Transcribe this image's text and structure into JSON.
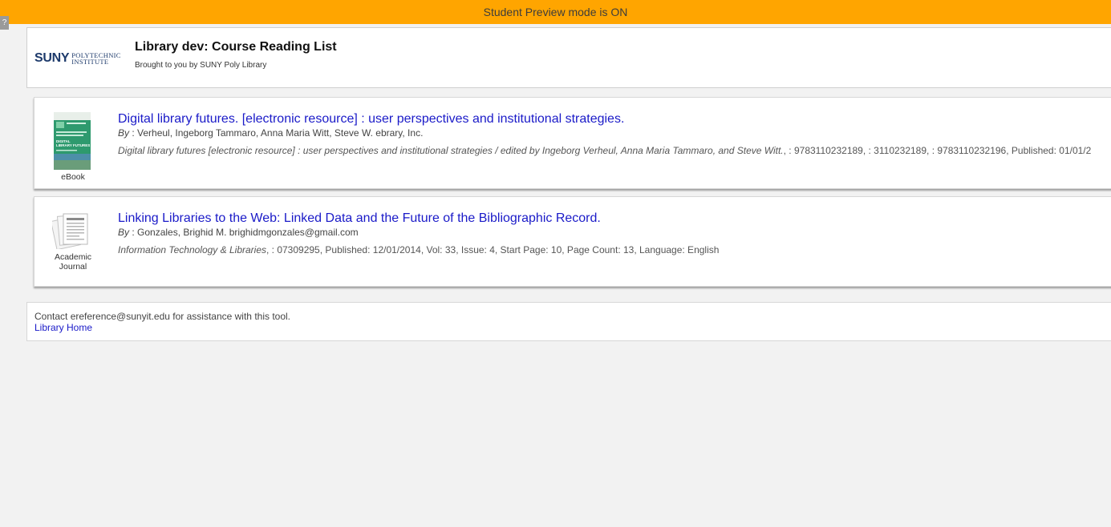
{
  "banner": {
    "text": "Student Preview mode is ON"
  },
  "side_tab": {
    "glyph": "?"
  },
  "header": {
    "logo_main": "SUNY",
    "logo_line1": "POLYTECHNIC",
    "logo_line2": "INSTITUTE",
    "title": "Library dev: Course Reading List",
    "subtitle": "Brought to you by SUNY Poly Library"
  },
  "items": [
    {
      "format": "eBook",
      "title": "Digital library futures. [electronic resource] : user perspectives and institutional strategies.",
      "by_label": "By",
      "authors": " : Verheul, Ingeborg Tammaro, Anna Maria Witt, Steve W. ebrary, Inc.",
      "source": "Digital library futures [electronic resource] : user perspectives and institutional strategies / edited by Ingeborg Verheul, Anna Maria Tammaro, and Steve Witt.",
      "details": ", : 9783110232189, : 3110232189, : 9783110232196, Published: 01/01/2",
      "cover_lines": [
        "DIGITAL",
        "LIBRARY FUTURES"
      ]
    },
    {
      "format": "Academic Journal",
      "title": "Linking Libraries to the Web: Linked Data and the Future of the Bibliographic Record.",
      "by_label": "By",
      "authors": " : Gonzales, Brighid M. brighidmgonzales@gmail.com",
      "source": "Information Technology & Libraries",
      "details": ", : 07309295, Published: 12/01/2014, Vol: 33, Issue: 4, Start Page: 10, Page Count: 13, Language: English"
    }
  ],
  "footer": {
    "contact": "Contact ereference@sunyit.edu for assistance with this tool.",
    "home_link": "Library Home"
  },
  "colors": {
    "banner": "#ffa500",
    "link": "#1a1ac8",
    "brand": "#1d3a6b",
    "cover": "#2e9a6e"
  }
}
